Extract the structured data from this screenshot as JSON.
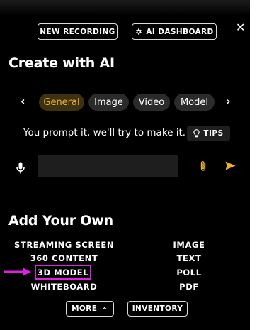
{
  "header": {
    "new_recording_label": "NEW RECORDING",
    "ai_dashboard_label": "AI DASHBOARD",
    "close_glyph": "✕",
    "icons": {
      "ai_dashboard": "gear-icon",
      "close": "close-icon"
    }
  },
  "create": {
    "title": "Create with AI",
    "tabs": [
      "General",
      "Image",
      "Video",
      "Model"
    ],
    "active_tab": "General",
    "prev_glyph": "‹",
    "next_glyph": "›",
    "prompt_text": "You prompt it, we'll try to make it.",
    "tips_label": "TIPS",
    "input": {
      "value": "",
      "placeholder": ""
    },
    "icons": {
      "tips": "lightbulb-icon",
      "mic": "microphone-icon",
      "attach": "paperclip-icon",
      "send": "send-icon"
    }
  },
  "add_own": {
    "title": "Add Your Own",
    "left_options": [
      "STREAMING SCREEN",
      "360 CONTENT",
      "3D MODEL",
      "WHITEBOARD"
    ],
    "right_options": [
      "IMAGE",
      "TEXT",
      "POLL",
      "PDF"
    ],
    "highlighted_option": "3D MODEL",
    "more_label": "MORE",
    "more_glyph": "⌃",
    "inventory_label": "INVENTORY"
  },
  "colors": {
    "panel_background": "#000000",
    "accent": "#e9b32f",
    "active_tab_background": "#3d3110",
    "tab_background": "#2b2b2b",
    "annotation": "#e31ee3"
  }
}
